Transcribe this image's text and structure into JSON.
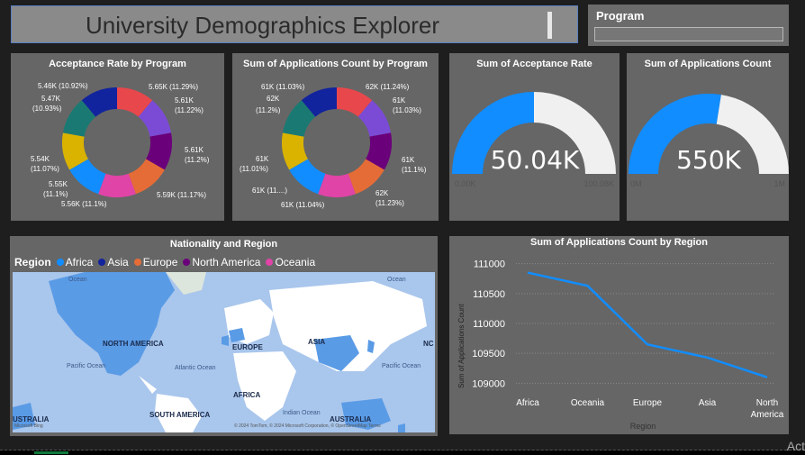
{
  "header": {
    "title": "University Demographics Explorer"
  },
  "slicer": {
    "label": "Program",
    "value": ""
  },
  "acceptance_donut": {
    "title": "Acceptance Rate by Program",
    "labels": [
      "5.65K (11.29%)",
      "5.61K (11.22%)",
      "5.61K (11.2%)",
      "5.59K (11.17%)",
      "5.56K (11.1%)",
      "5.55K (11.1%)",
      "5.54K (11.07%)",
      "5.47K (10.93%)",
      "5.46K (10.92%)"
    ]
  },
  "applications_donut": {
    "title": "Sum of Applications Count by Program",
    "labels": [
      "62K (11.24%)",
      "61K (11.03%)",
      "61K (11.1%)",
      "62K (11.23%)",
      "61K (11.04%)",
      "61K (11....)",
      "61K (11.01%)",
      "62K (11.2%)",
      "61K (11.03%)"
    ]
  },
  "gauge_acceptance": {
    "title": "Sum of Acceptance Rate",
    "value": "50.04K",
    "min": "0.00K",
    "max": "100.08K",
    "fraction": 0.5
  },
  "gauge_applications": {
    "title": "Sum of Applications Count",
    "value": "550K",
    "min": "0M",
    "max": "1M",
    "fraction": 0.55
  },
  "map": {
    "title": "Nationality and Region",
    "legend_title": "Region",
    "legend": [
      {
        "name": "Africa",
        "color": "#118dff"
      },
      {
        "name": "Asia",
        "color": "#12239e"
      },
      {
        "name": "Europe",
        "color": "#e66c37"
      },
      {
        "name": "North America",
        "color": "#6b007b"
      },
      {
        "name": "Oceania",
        "color": "#e044a7"
      }
    ],
    "labels": {
      "north_america": "NORTH AMERICA",
      "europe": "EUROPE",
      "asia": "ASIA",
      "africa": "AFRICA",
      "south_america": "SOUTH AMERICA",
      "australia": "AUSTRALIA",
      "australia_left": "USTRALIA",
      "pacific_left": "Pacific Ocean",
      "pacific_right": "Pacific Ocean",
      "atlantic": "Atlantic Ocean",
      "indian": "Indian Ocean",
      "ocean_top_left": "Ocean",
      "ocean_top_right": "Ocean",
      "na_edge": "NC",
      "attribution": "© 2024 TomTom, © 2024 Microsoft Corporation, © OpenStreetMap  Terms",
      "bing": "Microsoft Bing"
    }
  },
  "chart_data": {
    "type": "line",
    "title": "Sum of Applications Count by Region",
    "xlabel": "Region",
    "ylabel": "Sum of Applications Count",
    "categories": [
      "Africa",
      "Oceania",
      "Europe",
      "Asia",
      "North America"
    ],
    "values": [
      110850,
      110630,
      109650,
      109430,
      109100
    ],
    "yticks": [
      "111000",
      "110500",
      "110000",
      "109500",
      "109000"
    ],
    "ylim": [
      108900,
      111100
    ],
    "color": "#118dff"
  },
  "watermark": "Act",
  "colors": [
    "#e8474c",
    "#7b4bd6",
    "#6b007b",
    "#e66c37",
    "#e044a7",
    "#118dff",
    "#d9b300",
    "#1a7a73",
    "#12239e"
  ]
}
